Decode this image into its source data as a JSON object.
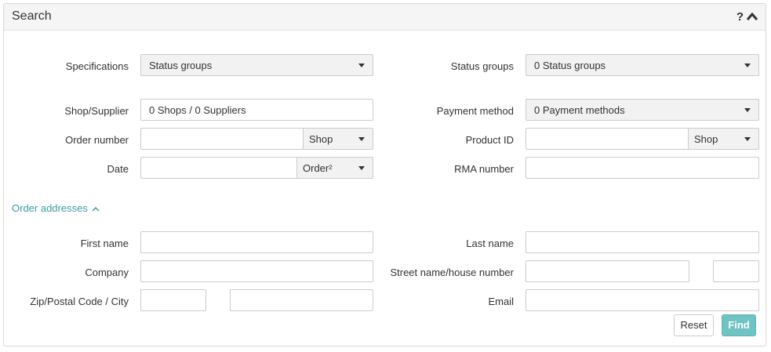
{
  "panel": {
    "title": "Search",
    "help_symbol": "?",
    "collapse_icon": "chevron-up-icon"
  },
  "fields": {
    "specifications": {
      "label": "Specifications",
      "value": "Status groups"
    },
    "status_groups": {
      "label": "Status groups",
      "value": "0 Status groups"
    },
    "shop_supplier": {
      "label": "Shop/Supplier",
      "value": "0 Shops / 0 Suppliers"
    },
    "payment_method": {
      "label": "Payment method",
      "value": "0 Payment methods"
    },
    "order_number": {
      "label": "Order number",
      "value": "",
      "addon": "Shop"
    },
    "product_id": {
      "label": "Product ID",
      "value": "",
      "addon": "Shop"
    },
    "date": {
      "label": "Date",
      "value": "",
      "addon": "Order²"
    },
    "rma_number": {
      "label": "RMA number",
      "value": ""
    }
  },
  "order_addresses": {
    "toggle_label": "Order addresses",
    "first_name": {
      "label": "First name",
      "value": ""
    },
    "last_name": {
      "label": "Last name",
      "value": ""
    },
    "company": {
      "label": "Company",
      "value": ""
    },
    "street": {
      "label": "Street name/house number",
      "value": "",
      "house_number": ""
    },
    "zip_city": {
      "label": "Zip/Postal Code / City",
      "zip": "",
      "city": ""
    },
    "email": {
      "label": "Email",
      "value": ""
    }
  },
  "buttons": {
    "reset": "Reset",
    "find": "Find"
  },
  "colors": {
    "accent": "#3a9ba8",
    "find_button": "#6fc3c2",
    "header_bg": "#f5f5f5",
    "select_bg": "#f2f2f2"
  }
}
